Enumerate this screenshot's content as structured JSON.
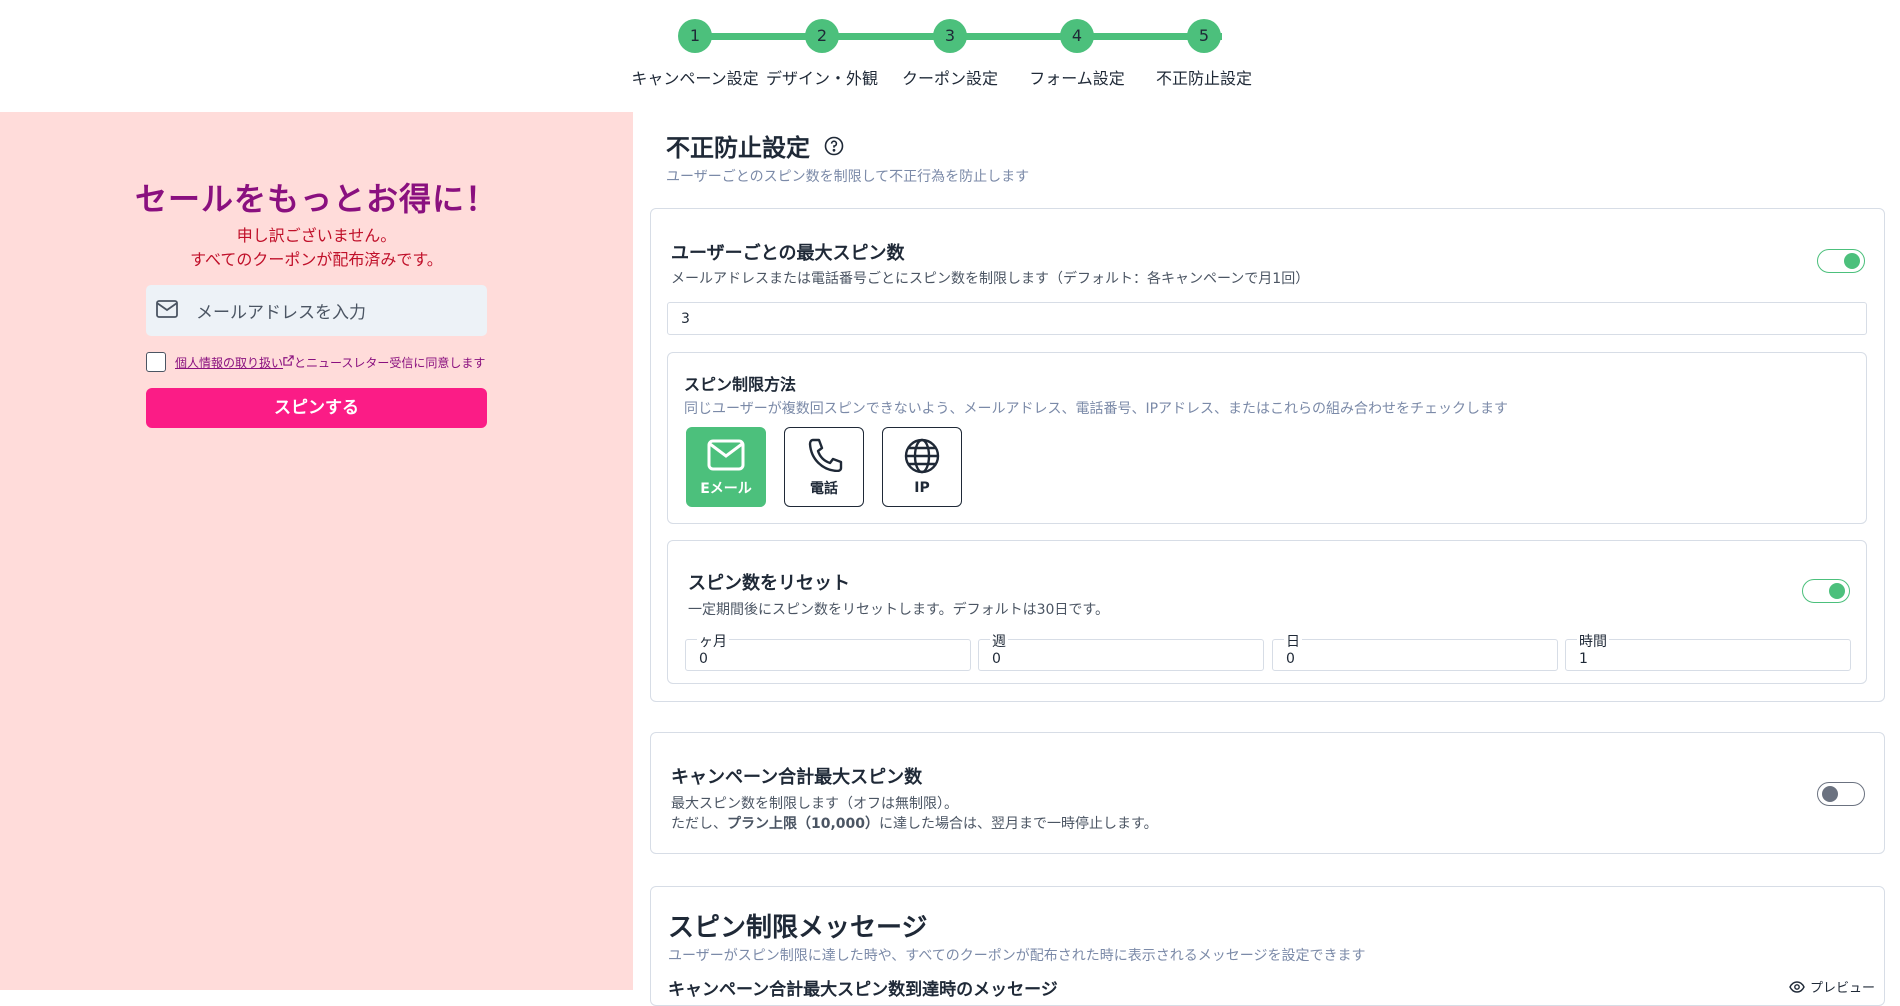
{
  "stepper": {
    "steps": [
      {
        "number": "1",
        "label": "キャンペーン設定"
      },
      {
        "number": "2",
        "label": "デザイン・外観"
      },
      {
        "number": "3",
        "label": "クーポン設定"
      },
      {
        "number": "4",
        "label": "フォーム設定"
      },
      {
        "number": "5",
        "label": "不正防止設定"
      }
    ],
    "accent": "#4cc07c"
  },
  "preview": {
    "title": "セールをもっとお得に！",
    "message_line1": "申し訳ございません。",
    "message_line2": "すべてのクーポンが配布済みです。",
    "email_placeholder": "メールアドレスを入力",
    "consent_link": "個人情報の取り扱い",
    "consent_text": "とニュースレター受信に同意します",
    "spin_button": "スピンする",
    "background": "#ffdcda",
    "button_color": "#fb1c86"
  },
  "settings": {
    "title": "不正防止設定",
    "subtitle": "ユーザーごとのスピン数を制限して不正行為を防止します",
    "max_spins": {
      "title": "ユーザーごとの最大スピン数",
      "desc": "メールアドレスまたは電話番号ごとにスピン数を制限します（デフォルト：各キャンペーンで月1回）",
      "value": "3",
      "enabled": true
    },
    "method": {
      "title": "スピン制限方法",
      "desc": "同じユーザーが複数回スピンできないよう、メールアドレス、電話番号、IPアドレス、またはこれらの組み合わせをチェックします",
      "options": [
        {
          "label": "Eメール",
          "icon": "mail-icon",
          "selected": true
        },
        {
          "label": "電話",
          "icon": "phone-icon",
          "selected": false
        },
        {
          "label": "IP",
          "icon": "globe-icon",
          "selected": false
        }
      ]
    },
    "reset": {
      "title": "スピン数をリセット",
      "desc": "一定期間後にスピン数をリセットします。デフォルトは30日です。",
      "enabled": true,
      "fields": [
        {
          "label": "ヶ月",
          "value": "0"
        },
        {
          "label": "週",
          "value": "0"
        },
        {
          "label": "日",
          "value": "0"
        },
        {
          "label": "時間",
          "value": "1"
        }
      ]
    },
    "campaign_total": {
      "title": "キャンペーン合計最大スピン数",
      "desc_line1": "最大スピン数を制限します（オフは無制限）。",
      "desc_line2_pre": "ただし、",
      "desc_line2_bold": "プラン上限（10,000）",
      "desc_line2_post": "に達した場合は、翌月まで一時停止します。",
      "enabled": false
    },
    "messages": {
      "title": "スピン制限メッセージ",
      "subtitle": "ユーザーがスピン制限に達した時や、すべてのクーポンが配布された時に表示されるメッセージを設定できます",
      "row_label": "キャンペーン合計最大スピン数到達時のメッセージ",
      "preview_label": "プレビュー"
    }
  }
}
